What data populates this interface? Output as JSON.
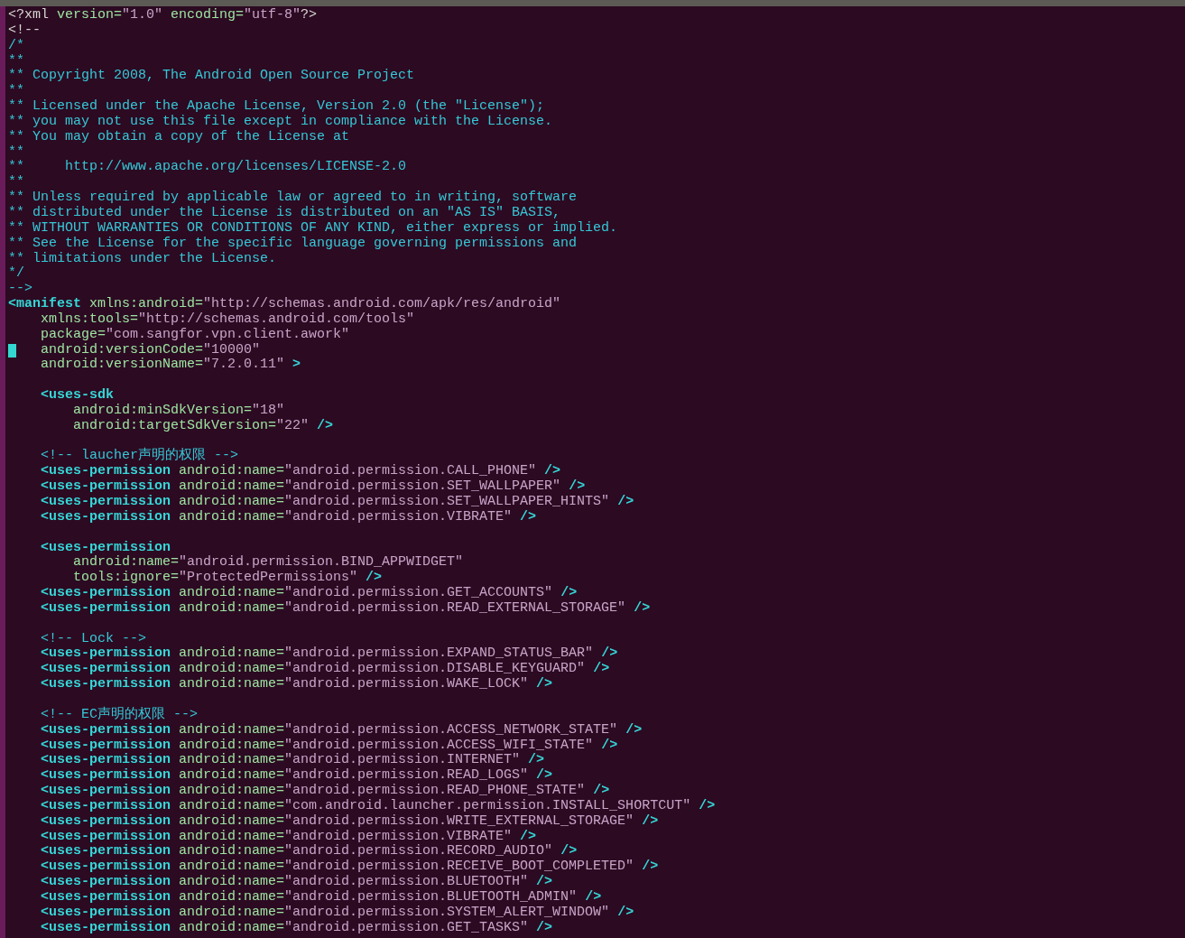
{
  "editor": {
    "lines": [
      {
        "cursor": false,
        "segments": [
          {
            "kind": "pi",
            "text": "<?xml"
          },
          {
            "kind": "attr",
            "text": " version="
          },
          {
            "kind": "value",
            "text": "\"1.0\""
          },
          {
            "kind": "attr",
            "text": " encoding="
          },
          {
            "kind": "value",
            "text": "\"utf-8\""
          },
          {
            "kind": "pi",
            "text": "?>"
          }
        ]
      },
      {
        "cursor": false,
        "segments": [
          {
            "kind": "pi",
            "text": "<!--"
          }
        ]
      },
      {
        "cursor": false,
        "segments": [
          {
            "kind": "comment",
            "text": "/*"
          }
        ]
      },
      {
        "cursor": false,
        "segments": [
          {
            "kind": "comment",
            "text": "**"
          }
        ]
      },
      {
        "cursor": false,
        "segments": [
          {
            "kind": "comment",
            "text": "** Copyright 2008, The Android Open Source Project"
          }
        ]
      },
      {
        "cursor": false,
        "segments": [
          {
            "kind": "comment",
            "text": "**"
          }
        ]
      },
      {
        "cursor": false,
        "segments": [
          {
            "kind": "comment",
            "text": "** Licensed under the Apache License, Version 2.0 (the \"License\");"
          }
        ]
      },
      {
        "cursor": false,
        "segments": [
          {
            "kind": "comment",
            "text": "** you may not use this file except in compliance with the License."
          }
        ]
      },
      {
        "cursor": false,
        "segments": [
          {
            "kind": "comment",
            "text": "** You may obtain a copy of the License at"
          }
        ]
      },
      {
        "cursor": false,
        "segments": [
          {
            "kind": "comment",
            "text": "**"
          }
        ]
      },
      {
        "cursor": false,
        "segments": [
          {
            "kind": "comment",
            "text": "**     http://www.apache.org/licenses/LICENSE-2.0"
          }
        ]
      },
      {
        "cursor": false,
        "segments": [
          {
            "kind": "comment",
            "text": "**"
          }
        ]
      },
      {
        "cursor": false,
        "segments": [
          {
            "kind": "comment",
            "text": "** Unless required by applicable law or agreed to in writing, software"
          }
        ]
      },
      {
        "cursor": false,
        "segments": [
          {
            "kind": "comment",
            "text": "** distributed under the License is distributed on an \"AS IS\" BASIS,"
          }
        ]
      },
      {
        "cursor": false,
        "segments": [
          {
            "kind": "comment",
            "text": "** WITHOUT WARRANTIES OR CONDITIONS OF ANY KIND, either express or implied."
          }
        ]
      },
      {
        "cursor": false,
        "segments": [
          {
            "kind": "comment",
            "text": "** See the License for the specific language governing permissions and"
          }
        ]
      },
      {
        "cursor": false,
        "segments": [
          {
            "kind": "comment",
            "text": "** limitations under the License."
          }
        ]
      },
      {
        "cursor": false,
        "segments": [
          {
            "kind": "comment",
            "text": "*/"
          }
        ]
      },
      {
        "cursor": false,
        "segments": [
          {
            "kind": "comment",
            "text": "-->"
          }
        ]
      },
      {
        "cursor": false,
        "segments": [
          {
            "kind": "tag",
            "text": "<manifest"
          },
          {
            "kind": "attr",
            "text": " xmlns:android="
          },
          {
            "kind": "value",
            "text": "\"http://schemas.android.com/apk/res/android\""
          }
        ]
      },
      {
        "cursor": false,
        "segments": [
          {
            "kind": "attr",
            "text": "    xmlns:tools="
          },
          {
            "kind": "value",
            "text": "\"http://schemas.android.com/tools\""
          }
        ]
      },
      {
        "cursor": false,
        "segments": [
          {
            "kind": "attr",
            "text": "    package="
          },
          {
            "kind": "value",
            "text": "\"com.sangfor.vpn.client.awork\""
          }
        ]
      },
      {
        "cursor": true,
        "segments": [
          {
            "kind": "attr",
            "text": "    android:versionCode="
          },
          {
            "kind": "value",
            "text": "\"10000\""
          }
        ]
      },
      {
        "cursor": false,
        "segments": [
          {
            "kind": "attr",
            "text": "    android:versionName="
          },
          {
            "kind": "value",
            "text": "\"7.2.0.11\""
          },
          {
            "kind": "punct",
            "text": " >"
          }
        ]
      },
      {
        "cursor": false
      },
      {
        "cursor": false,
        "segments": [
          {
            "kind": "tag",
            "text": "    <uses-sdk"
          }
        ]
      },
      {
        "cursor": false,
        "segments": [
          {
            "kind": "attr",
            "text": "        android:minSdkVersion="
          },
          {
            "kind": "value",
            "text": "\"18\""
          }
        ]
      },
      {
        "cursor": false,
        "segments": [
          {
            "kind": "attr",
            "text": "        android:targetSdkVersion="
          },
          {
            "kind": "value",
            "text": "\"22\""
          },
          {
            "kind": "punct",
            "text": " />"
          }
        ]
      },
      {
        "cursor": false
      },
      {
        "cursor": false,
        "segments": [
          {
            "kind": "comment",
            "text": "    <!-- laucher声明的权限 -->"
          }
        ]
      },
      {
        "cursor": false,
        "segments": [
          {
            "kind": "tag",
            "text": "    <uses-permission"
          },
          {
            "kind": "attr",
            "text": " android:name="
          },
          {
            "kind": "value",
            "text": "\"android.permission.CALL_PHONE\""
          },
          {
            "kind": "punct",
            "text": " />"
          }
        ]
      },
      {
        "cursor": false,
        "segments": [
          {
            "kind": "tag",
            "text": "    <uses-permission"
          },
          {
            "kind": "attr",
            "text": " android:name="
          },
          {
            "kind": "value",
            "text": "\"android.permission.SET_WALLPAPER\""
          },
          {
            "kind": "punct",
            "text": " />"
          }
        ]
      },
      {
        "cursor": false,
        "segments": [
          {
            "kind": "tag",
            "text": "    <uses-permission"
          },
          {
            "kind": "attr",
            "text": " android:name="
          },
          {
            "kind": "value",
            "text": "\"android.permission.SET_WALLPAPER_HINTS\""
          },
          {
            "kind": "punct",
            "text": " />"
          }
        ]
      },
      {
        "cursor": false,
        "segments": [
          {
            "kind": "tag",
            "text": "    <uses-permission"
          },
          {
            "kind": "attr",
            "text": " android:name="
          },
          {
            "kind": "value",
            "text": "\"android.permission.VIBRATE\""
          },
          {
            "kind": "punct",
            "text": " />"
          }
        ]
      },
      {
        "cursor": false
      },
      {
        "cursor": false,
        "segments": [
          {
            "kind": "tag",
            "text": "    <uses-permission"
          }
        ]
      },
      {
        "cursor": false,
        "segments": [
          {
            "kind": "attr",
            "text": "        android:name="
          },
          {
            "kind": "value",
            "text": "\"android.permission.BIND_APPWIDGET\""
          }
        ]
      },
      {
        "cursor": false,
        "segments": [
          {
            "kind": "attr",
            "text": "        tools:ignore="
          },
          {
            "kind": "value",
            "text": "\"ProtectedPermissions\""
          },
          {
            "kind": "punct",
            "text": " />"
          }
        ]
      },
      {
        "cursor": false,
        "segments": [
          {
            "kind": "tag",
            "text": "    <uses-permission"
          },
          {
            "kind": "attr",
            "text": " android:name="
          },
          {
            "kind": "value",
            "text": "\"android.permission.GET_ACCOUNTS\""
          },
          {
            "kind": "punct",
            "text": " />"
          }
        ]
      },
      {
        "cursor": false,
        "segments": [
          {
            "kind": "tag",
            "text": "    <uses-permission"
          },
          {
            "kind": "attr",
            "text": " android:name="
          },
          {
            "kind": "value",
            "text": "\"android.permission.READ_EXTERNAL_STORAGE\""
          },
          {
            "kind": "punct",
            "text": " />"
          }
        ]
      },
      {
        "cursor": false
      },
      {
        "cursor": false,
        "segments": [
          {
            "kind": "comment",
            "text": "    <!-- Lock -->"
          }
        ]
      },
      {
        "cursor": false,
        "segments": [
          {
            "kind": "tag",
            "text": "    <uses-permission"
          },
          {
            "kind": "attr",
            "text": " android:name="
          },
          {
            "kind": "value",
            "text": "\"android.permission.EXPAND_STATUS_BAR\""
          },
          {
            "kind": "punct",
            "text": " />"
          }
        ]
      },
      {
        "cursor": false,
        "segments": [
          {
            "kind": "tag",
            "text": "    <uses-permission"
          },
          {
            "kind": "attr",
            "text": " android:name="
          },
          {
            "kind": "value",
            "text": "\"android.permission.DISABLE_KEYGUARD\""
          },
          {
            "kind": "punct",
            "text": " />"
          }
        ]
      },
      {
        "cursor": false,
        "segments": [
          {
            "kind": "tag",
            "text": "    <uses-permission"
          },
          {
            "kind": "attr",
            "text": " android:name="
          },
          {
            "kind": "value",
            "text": "\"android.permission.WAKE_LOCK\""
          },
          {
            "kind": "punct",
            "text": " />"
          }
        ]
      },
      {
        "cursor": false
      },
      {
        "cursor": false,
        "segments": [
          {
            "kind": "comment",
            "text": "    <!-- EC声明的权限 -->"
          }
        ]
      },
      {
        "cursor": false,
        "segments": [
          {
            "kind": "tag",
            "text": "    <uses-permission"
          },
          {
            "kind": "attr",
            "text": " android:name="
          },
          {
            "kind": "value",
            "text": "\"android.permission.ACCESS_NETWORK_STATE\""
          },
          {
            "kind": "punct",
            "text": " />"
          }
        ]
      },
      {
        "cursor": false,
        "segments": [
          {
            "kind": "tag",
            "text": "    <uses-permission"
          },
          {
            "kind": "attr",
            "text": " android:name="
          },
          {
            "kind": "value",
            "text": "\"android.permission.ACCESS_WIFI_STATE\""
          },
          {
            "kind": "punct",
            "text": " />"
          }
        ]
      },
      {
        "cursor": false,
        "segments": [
          {
            "kind": "tag",
            "text": "    <uses-permission"
          },
          {
            "kind": "attr",
            "text": " android:name="
          },
          {
            "kind": "value",
            "text": "\"android.permission.INTERNET\""
          },
          {
            "kind": "punct",
            "text": " />"
          }
        ]
      },
      {
        "cursor": false,
        "segments": [
          {
            "kind": "tag",
            "text": "    <uses-permission"
          },
          {
            "kind": "attr",
            "text": " android:name="
          },
          {
            "kind": "value",
            "text": "\"android.permission.READ_LOGS\""
          },
          {
            "kind": "punct",
            "text": " />"
          }
        ]
      },
      {
        "cursor": false,
        "segments": [
          {
            "kind": "tag",
            "text": "    <uses-permission"
          },
          {
            "kind": "attr",
            "text": " android:name="
          },
          {
            "kind": "value",
            "text": "\"android.permission.READ_PHONE_STATE\""
          },
          {
            "kind": "punct",
            "text": " />"
          }
        ]
      },
      {
        "cursor": false,
        "segments": [
          {
            "kind": "tag",
            "text": "    <uses-permission"
          },
          {
            "kind": "attr",
            "text": " android:name="
          },
          {
            "kind": "value",
            "text": "\"com.android.launcher.permission.INSTALL_SHORTCUT\""
          },
          {
            "kind": "punct",
            "text": " />"
          }
        ]
      },
      {
        "cursor": false,
        "segments": [
          {
            "kind": "tag",
            "text": "    <uses-permission"
          },
          {
            "kind": "attr",
            "text": " android:name="
          },
          {
            "kind": "value",
            "text": "\"android.permission.WRITE_EXTERNAL_STORAGE\""
          },
          {
            "kind": "punct",
            "text": " />"
          }
        ]
      },
      {
        "cursor": false,
        "segments": [
          {
            "kind": "tag",
            "text": "    <uses-permission"
          },
          {
            "kind": "attr",
            "text": " android:name="
          },
          {
            "kind": "value",
            "text": "\"android.permission.VIBRATE\""
          },
          {
            "kind": "punct",
            "text": " />"
          }
        ]
      },
      {
        "cursor": false,
        "segments": [
          {
            "kind": "tag",
            "text": "    <uses-permission"
          },
          {
            "kind": "attr",
            "text": " android:name="
          },
          {
            "kind": "value",
            "text": "\"android.permission.RECORD_AUDIO\""
          },
          {
            "kind": "punct",
            "text": " />"
          }
        ]
      },
      {
        "cursor": false,
        "segments": [
          {
            "kind": "tag",
            "text": "    <uses-permission"
          },
          {
            "kind": "attr",
            "text": " android:name="
          },
          {
            "kind": "value",
            "text": "\"android.permission.RECEIVE_BOOT_COMPLETED\""
          },
          {
            "kind": "punct",
            "text": " />"
          }
        ]
      },
      {
        "cursor": false,
        "segments": [
          {
            "kind": "tag",
            "text": "    <uses-permission"
          },
          {
            "kind": "attr",
            "text": " android:name="
          },
          {
            "kind": "value",
            "text": "\"android.permission.BLUETOOTH\""
          },
          {
            "kind": "punct",
            "text": " />"
          }
        ]
      },
      {
        "cursor": false,
        "segments": [
          {
            "kind": "tag",
            "text": "    <uses-permission"
          },
          {
            "kind": "attr",
            "text": " android:name="
          },
          {
            "kind": "value",
            "text": "\"android.permission.BLUETOOTH_ADMIN\""
          },
          {
            "kind": "punct",
            "text": " />"
          }
        ]
      },
      {
        "cursor": false,
        "segments": [
          {
            "kind": "tag",
            "text": "    <uses-permission"
          },
          {
            "kind": "attr",
            "text": " android:name="
          },
          {
            "kind": "value",
            "text": "\"android.permission.SYSTEM_ALERT_WINDOW\""
          },
          {
            "kind": "punct",
            "text": " />"
          }
        ]
      },
      {
        "cursor": false,
        "segments": [
          {
            "kind": "tag",
            "text": "    <uses-permission"
          },
          {
            "kind": "attr",
            "text": " android:name="
          },
          {
            "kind": "value",
            "text": "\"android.permission.GET_TASKS\""
          },
          {
            "kind": "punct",
            "text": " />"
          }
        ]
      }
    ]
  }
}
